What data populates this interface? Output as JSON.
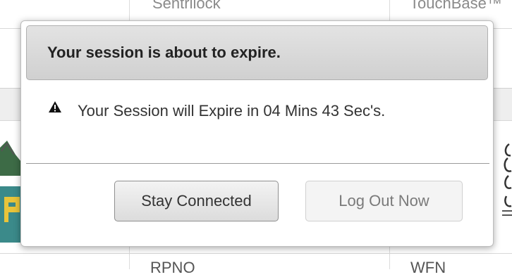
{
  "background": {
    "header_cells": [
      "Sentrilock",
      "TouchBase™"
    ],
    "footer_cells": [
      "RPNO",
      "WFN"
    ]
  },
  "modal": {
    "title": "Your session is about to expire.",
    "message": "Your Session will Expire in 04 Mins 43 Sec's.",
    "warning_icon": "warning-icon",
    "buttons": {
      "stay": "Stay Connected",
      "logout": "Log Out Now"
    }
  }
}
